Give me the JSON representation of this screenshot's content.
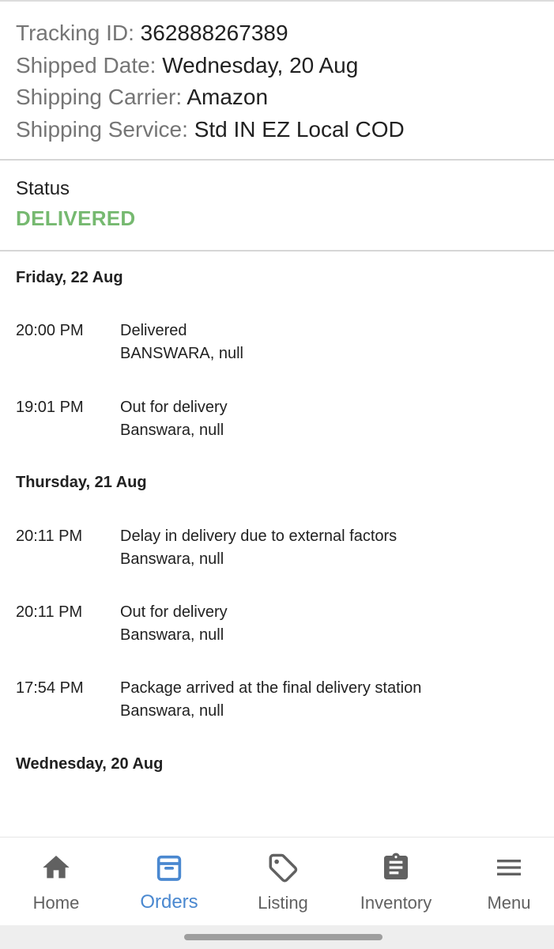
{
  "shipment": {
    "tracking_label": "Tracking ID: ",
    "tracking_value": "362888267389",
    "shipped_label": "Shipped Date: ",
    "shipped_value": "Wednesday, 20 Aug",
    "carrier_label": "Shipping Carrier: ",
    "carrier_value": "Amazon",
    "service_label": "Shipping Service: ",
    "service_value": "Std IN EZ Local COD"
  },
  "status": {
    "label": "Status",
    "value": "DELIVERED",
    "color": "#76b970"
  },
  "timeline": [
    {
      "date": "Friday, 22 Aug",
      "events": [
        {
          "time": "20:00 PM",
          "desc": "Delivered",
          "location": "BANSWARA, null"
        },
        {
          "time": "19:01 PM",
          "desc": "Out for delivery",
          "location": "Banswara, null"
        }
      ]
    },
    {
      "date": "Thursday, 21 Aug",
      "events": [
        {
          "time": "20:11 PM",
          "desc": "Delay in delivery due to external factors",
          "location": "Banswara, null"
        },
        {
          "time": "20:11 PM",
          "desc": "Out for delivery",
          "location": "Banswara, null"
        },
        {
          "time": "17:54 PM",
          "desc": "Package arrived at the final delivery station",
          "location": "Banswara, null"
        }
      ]
    },
    {
      "date": "Wednesday, 20 Aug",
      "events": []
    }
  ],
  "nav": {
    "items": [
      {
        "label": "Home",
        "icon": "home-icon"
      },
      {
        "label": "Orders",
        "icon": "orders-box-icon",
        "active": true
      },
      {
        "label": "Listing",
        "icon": "tag-icon"
      },
      {
        "label": "Inventory",
        "icon": "clipboard-icon"
      },
      {
        "label": "Menu",
        "icon": "hamburger-menu-icon"
      }
    ],
    "active_color": "#4a88d0"
  }
}
